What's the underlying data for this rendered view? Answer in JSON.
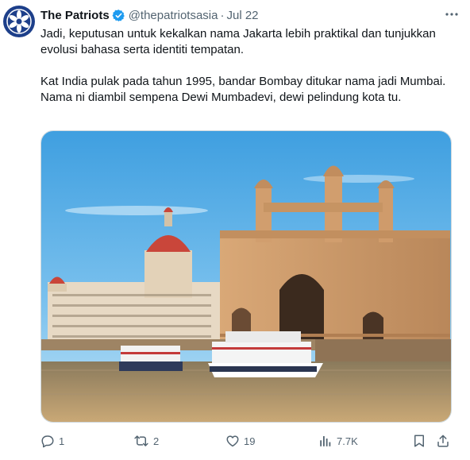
{
  "author": {
    "name": "The Patriots",
    "handle": "@thepatriotsasia",
    "separator": "·",
    "date": "Jul 22"
  },
  "tweet": {
    "paragraphs": [
      "Jadi, keputusan untuk kekalkan nama Jakarta lebih praktikal dan tunjukkan evolusi bahasa serta identiti tempatan.",
      "Kat India pulak pada tahun 1995, bandar Bombay ditukar nama jadi Mumbai. Nama ni diambil sempena Dewi Mumbadevi, dewi pelindung kota tu."
    ]
  },
  "actions": {
    "replies": "1",
    "reposts": "2",
    "likes": "19",
    "views": "7.7K"
  },
  "colors": {
    "text": "#0f1419",
    "secondary": "#536471",
    "verified": "#1d9bf0",
    "avatar_bg": "#1d3f8a"
  },
  "icons": [
    "patriots-logo-icon",
    "verified-badge-icon",
    "more-options-icon",
    "reply-icon",
    "repost-icon",
    "like-icon",
    "views-icon",
    "bookmark-icon",
    "share-icon"
  ]
}
